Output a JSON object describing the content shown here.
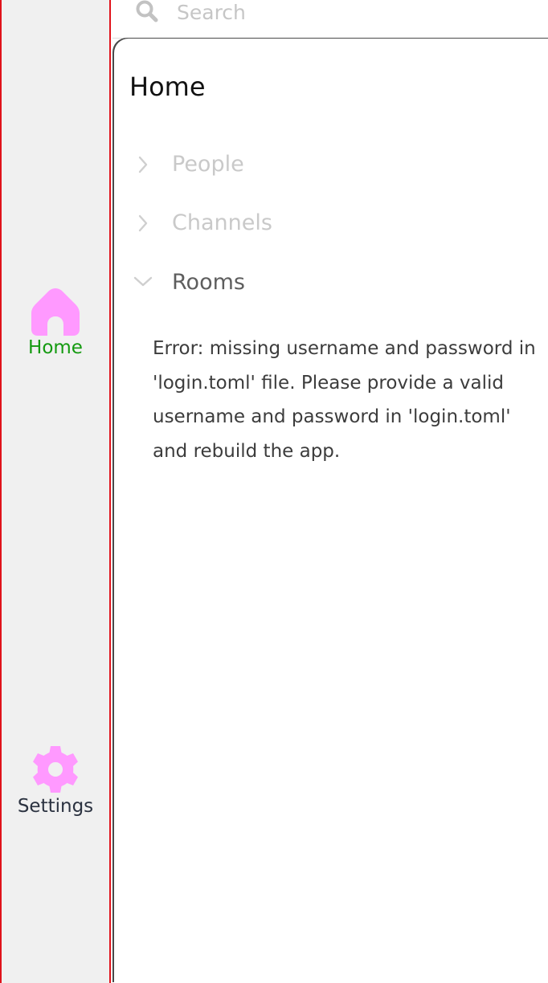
{
  "search": {
    "placeholder": "Search"
  },
  "sidebar": {
    "items": [
      {
        "label": "Home",
        "icon": "home-icon",
        "active": true,
        "label_color": "#149a10",
        "icon_color": "#ff99ff"
      },
      {
        "label": "Settings",
        "icon": "gear-icon",
        "active": false,
        "label_color": "#2b3240",
        "icon_color": "#ff99ff"
      }
    ]
  },
  "main": {
    "title": "Home",
    "sections": [
      {
        "label": "People",
        "expanded": false,
        "icon": "chevron-right-icon"
      },
      {
        "label": "Channels",
        "expanded": false,
        "icon": "chevron-right-icon"
      },
      {
        "label": "Rooms",
        "expanded": true,
        "icon": "chevron-down-icon"
      }
    ],
    "error_message": "Error: missing username and password in 'login.toml' file. Please provide a valid username and password in 'login.toml' and rebuild the app."
  },
  "colors": {
    "sidebar_background": "#f0f0f0",
    "sidebar_border": "#e0121b",
    "accent": "#149a10",
    "icon_pink": "#ff99ff"
  }
}
